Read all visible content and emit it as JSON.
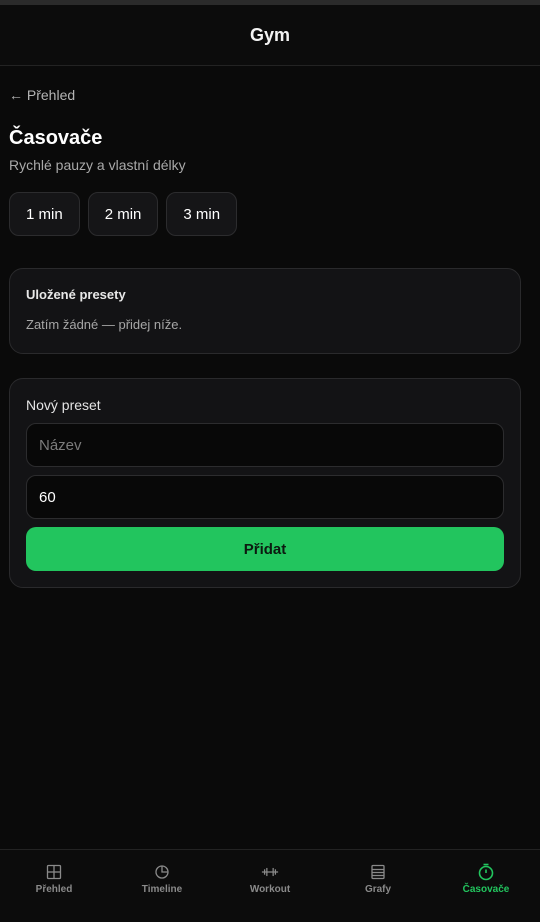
{
  "header": {
    "title": "Gym"
  },
  "back": {
    "label": "← Přehled"
  },
  "page": {
    "title": "Časovače",
    "subtitle": "Rychlé pauzy a vlastní délky"
  },
  "quick_timers": [
    {
      "label": "1 min"
    },
    {
      "label": "2 min"
    },
    {
      "label": "3 min"
    }
  ],
  "saved": {
    "title": "Uložené presety",
    "empty_text": "Zatím žádné — přidej níže."
  },
  "new_preset": {
    "title": "Nový preset",
    "name_placeholder": "Název",
    "name_value": "",
    "seconds_value": "60",
    "add_label": "Přidat"
  },
  "nav": {
    "items": [
      {
        "label": "Přehled",
        "icon": "grid-icon",
        "active": false
      },
      {
        "label": "Timeline",
        "icon": "pie-clock-icon",
        "active": false
      },
      {
        "label": "Workout",
        "icon": "dumbbell-icon",
        "active": false
      },
      {
        "label": "Grafy",
        "icon": "list-icon",
        "active": false
      },
      {
        "label": "Časovače",
        "icon": "stopwatch-icon",
        "active": true
      }
    ]
  },
  "colors": {
    "accent": "#22c55e",
    "background": "#0a0a0a",
    "card": "#131315"
  }
}
